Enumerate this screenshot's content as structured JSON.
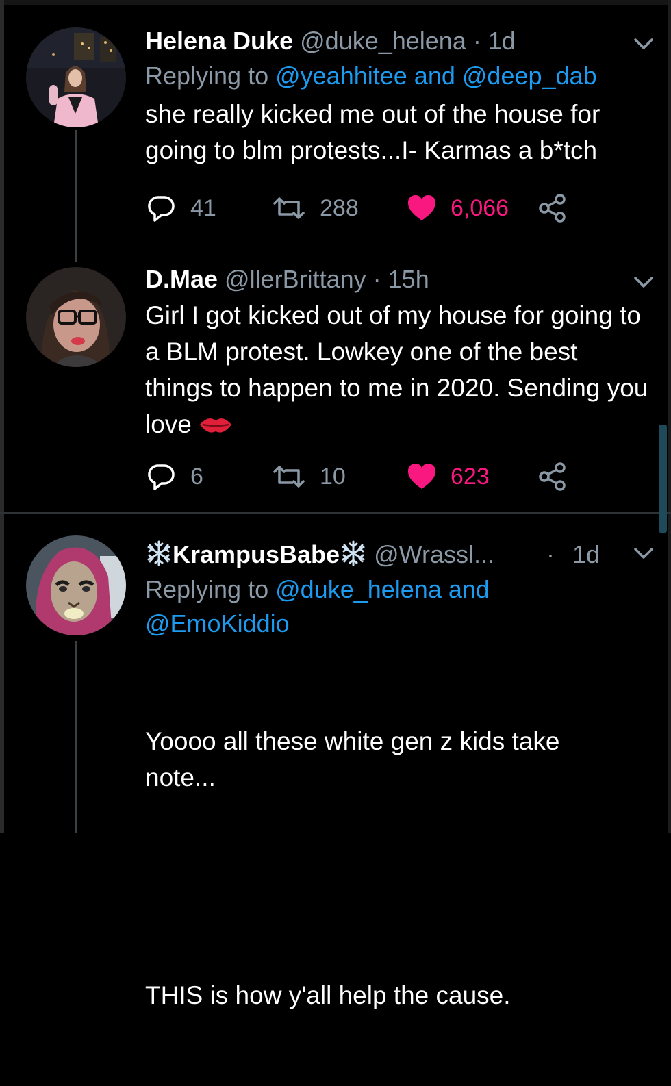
{
  "tweets": [
    {
      "name": "Helena Duke",
      "handle": "@duke_helena",
      "dot": " · ",
      "time": "1d",
      "reply_prefix": "Replying to ",
      "mention_1": "@yeahhitee",
      "reply_joiner": " and ",
      "mention_2": "@deep_dab",
      "body": "she really kicked me out of the house for going to blm protests...I- Karmas a b*tch",
      "replies": "41",
      "retweets": "288",
      "likes": "6,066"
    },
    {
      "name": "D.Mae",
      "handle": "@llerBrittany",
      "dot": " · ",
      "time": "15h",
      "body": "Girl I got kicked out of my house for going to a BLM protest. Lowkey one of the best things to happen to me in 2020. Sending you love",
      "emoji": "kiss-mark-emoji",
      "replies": "6",
      "retweets": "10",
      "likes": "623"
    },
    {
      "name": "KrampusBabe",
      "name_icon": "snowflake-icon",
      "handle": "@Wrassl...",
      "dot": " · ",
      "time": "1d",
      "reply_prefix": "Replying to ",
      "mention_1": "@duke_helena",
      "reply_joiner": " and",
      "mention_2": "@EmoKiddio",
      "body_line_1": "Yoooo all these white gen z kids take note...",
      "body_line_2": "THIS is how y'all help the cause."
    }
  ],
  "icons": {
    "reply": "reply-icon",
    "retweet": "retweet-icon",
    "like": "heart-icon",
    "share": "share-icon",
    "more": "chevron-down-icon"
  },
  "colors": {
    "background": "#000000",
    "secondary_text": "#8b98a5",
    "mention": "#1d9bf0",
    "like": "#f91880"
  }
}
